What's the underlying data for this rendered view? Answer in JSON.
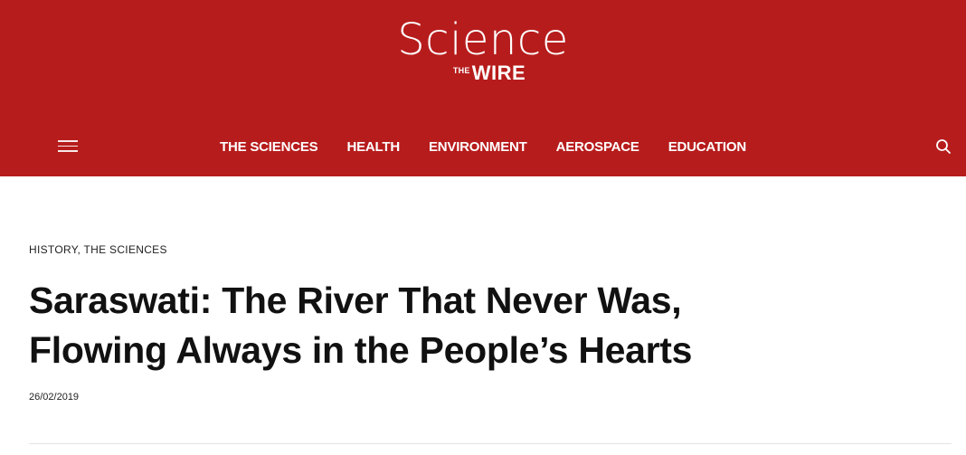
{
  "header": {
    "background_color": "#b71c1c",
    "logo": {
      "science": "Science",
      "the": "THE",
      "wire": "WIRE"
    },
    "menu_icon": "hamburger-menu-icon",
    "search_icon": "search-icon",
    "nav": [
      {
        "label": "THE SCIENCES"
      },
      {
        "label": "HEALTH"
      },
      {
        "label": "ENVIRONMENT"
      },
      {
        "label": "AEROSPACE"
      },
      {
        "label": "EDUCATION"
      }
    ]
  },
  "article": {
    "categories": "HISTORY, THE SCIENCES",
    "title": "Saraswati: The River That Never Was, Flowing Always in the People’s Hearts",
    "date": "26/02/2019"
  }
}
